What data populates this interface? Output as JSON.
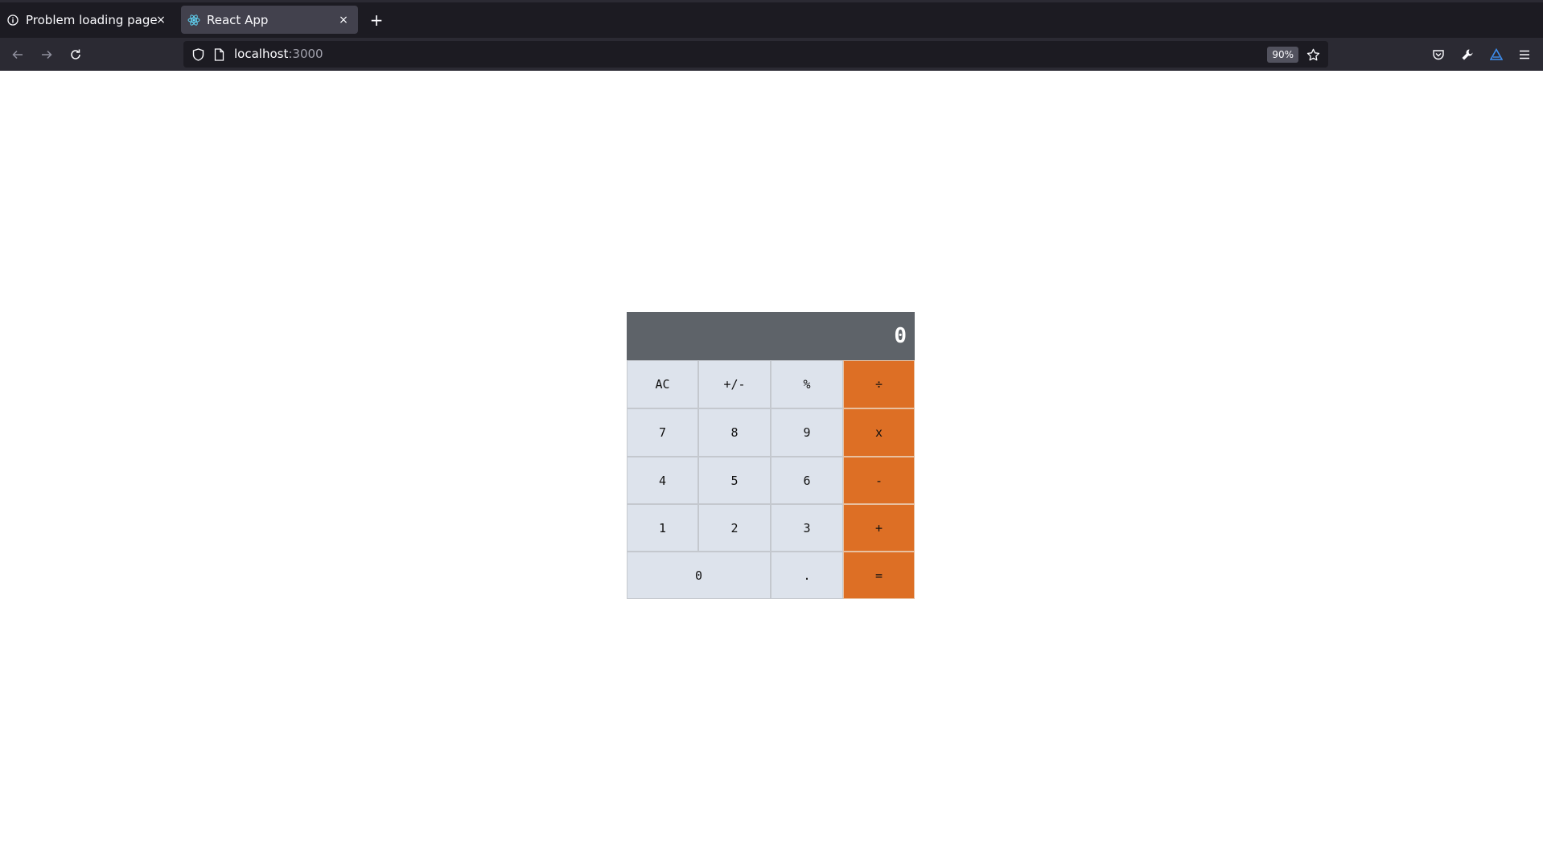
{
  "browser": {
    "tabs": [
      {
        "label": "Problem loading page",
        "icon": "info-icon",
        "active": false
      },
      {
        "label": "React App",
        "icon": "react-icon",
        "active": true
      }
    ],
    "close_glyph": "×",
    "new_tab_glyph": "+",
    "url": {
      "host": "localhost",
      "port": ":3000"
    },
    "zoom": "90%"
  },
  "calculator": {
    "display": "0",
    "keys": [
      {
        "label": "AC",
        "type": "function"
      },
      {
        "label": "+/-",
        "type": "function"
      },
      {
        "label": "%",
        "type": "function"
      },
      {
        "label": "÷",
        "type": "operator"
      },
      {
        "label": "7",
        "type": "digit"
      },
      {
        "label": "8",
        "type": "digit"
      },
      {
        "label": "9",
        "type": "digit"
      },
      {
        "label": "x",
        "type": "operator"
      },
      {
        "label": "4",
        "type": "digit"
      },
      {
        "label": "5",
        "type": "digit"
      },
      {
        "label": "6",
        "type": "digit"
      },
      {
        "label": "-",
        "type": "operator"
      },
      {
        "label": "1",
        "type": "digit"
      },
      {
        "label": "2",
        "type": "digit"
      },
      {
        "label": "3",
        "type": "digit"
      },
      {
        "label": "+",
        "type": "operator"
      },
      {
        "label": "0",
        "type": "digit"
      },
      {
        "label": ".",
        "type": "digit"
      },
      {
        "label": "=",
        "type": "operator"
      }
    ],
    "colors": {
      "display_bg": "#5e6369",
      "key_bg": "#dde3ec",
      "operator_bg": "#dd6f25"
    }
  }
}
